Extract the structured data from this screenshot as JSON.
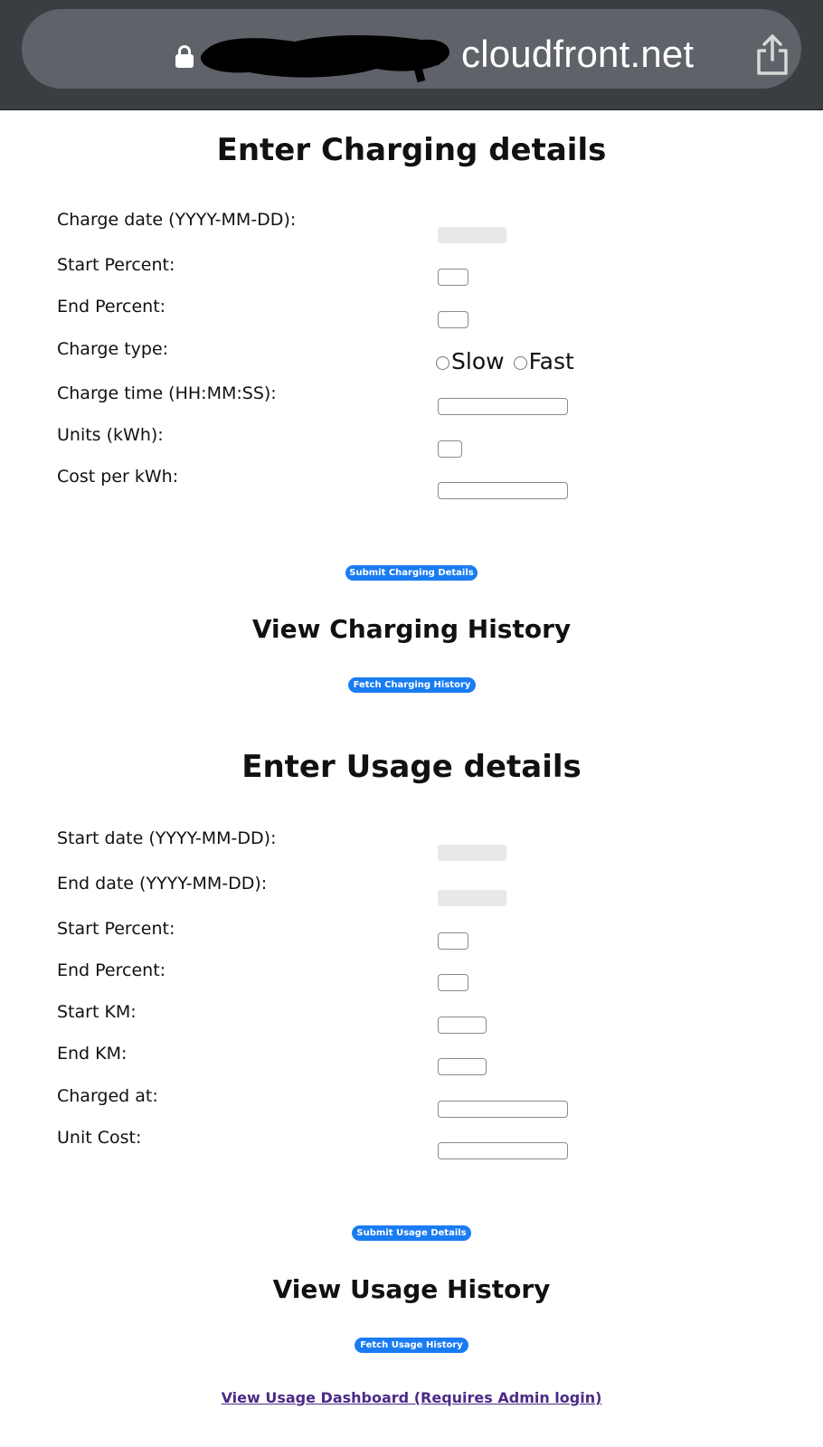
{
  "browser": {
    "url_visible": "cloudfront.net",
    "lock_icon": "lock-icon",
    "share_icon": "share-icon"
  },
  "charging": {
    "title": "Enter Charging details",
    "charge_date_label": "Charge date (YYYY-MM-DD):",
    "start_percent_label": "Start Percent:",
    "end_percent_label": "End Percent:",
    "charge_type_label": "Charge type:",
    "charge_type_options": [
      "Slow",
      "Fast"
    ],
    "charge_time_label": "Charge time (HH:MM:SS):",
    "units_label": "Units (kWh):",
    "cost_per_kwh_label": "Cost per kWh:",
    "submit_label": "Submit Charging Details"
  },
  "charging_history": {
    "title": "View Charging History",
    "fetch_label": "Fetch Charging History"
  },
  "usage": {
    "title": "Enter Usage details",
    "start_date_label": "Start date (YYYY-MM-DD):",
    "end_date_label": "End date (YYYY-MM-DD):",
    "start_percent_label": "Start Percent:",
    "end_percent_label": "End Percent:",
    "start_km_label": "Start KM:",
    "end_km_label": "End KM:",
    "charged_at_label": "Charged at:",
    "unit_cost_label": "Unit Cost:",
    "submit_label": "Submit Usage Details"
  },
  "usage_history": {
    "title": "View Usage History",
    "fetch_label": "Fetch Usage History"
  },
  "dashboard_link": "View Usage Dashboard (Requires Admin login)",
  "colors": {
    "button_blue": "#1a7cf2",
    "link_purple": "#4b2a86",
    "chrome_bg": "#3a3d42",
    "urlbar_bg": "#5f6369"
  }
}
